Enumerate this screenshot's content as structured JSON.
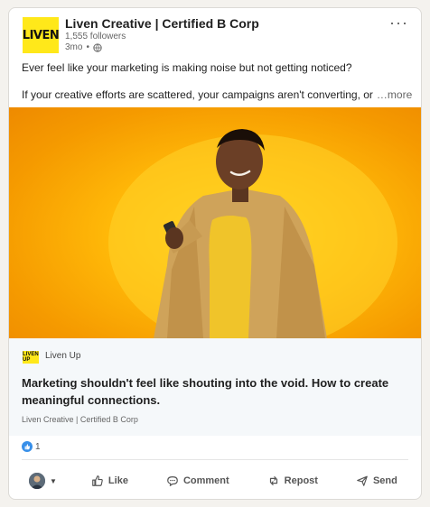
{
  "company": {
    "logo_text": "LIVEN",
    "name": "Liven Creative | Certified B Corp",
    "followers": "1,555 followers",
    "age": "3mo",
    "dot": "•"
  },
  "post": {
    "line1": "Ever feel like your marketing is making noise but not getting noticed?",
    "line2": "If your creative efforts are scattered, your campaigns aren't converting, or",
    "see_more": "…more"
  },
  "link_preview": {
    "source_logo_text": "LIVEN UP",
    "source_name": "Liven Up",
    "title": "Marketing shouldn't feel like shouting into the void. How to create meaningful connections.",
    "subtitle": "Liven Creative | Certified B Corp"
  },
  "reactions": {
    "count": "1",
    "icon": "like-reaction-icon"
  },
  "actions": {
    "like": "Like",
    "comment": "Comment",
    "repost": "Repost",
    "send": "Send"
  },
  "colors": {
    "brand_yellow": "#ffe81a",
    "hero_orange": "#f59a00",
    "reaction_blue": "#378fe9"
  }
}
